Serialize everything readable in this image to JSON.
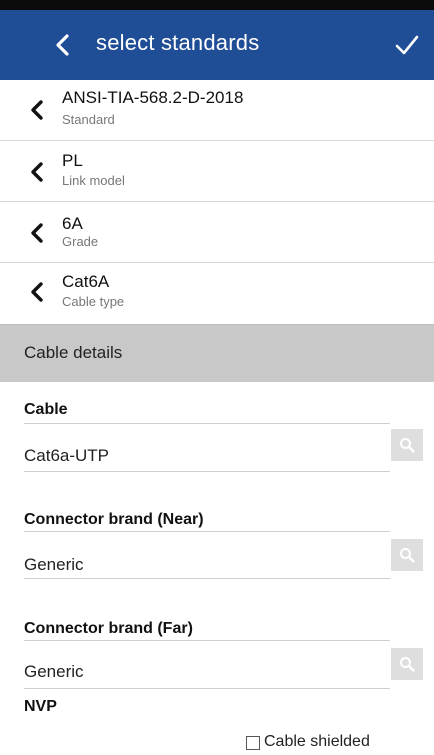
{
  "header": {
    "title": "select standards",
    "back_icon": "chevron-left-icon",
    "confirm_icon": "check-icon",
    "background": "#1f4d96"
  },
  "selections": [
    {
      "value": "ANSI-TIA-568.2-D-2018",
      "label": "Standard"
    },
    {
      "value": "PL",
      "label": "Link model"
    },
    {
      "value": "6A",
      "label": "Grade"
    },
    {
      "value": "Cat6A",
      "label": "Cable type"
    }
  ],
  "section": {
    "title": "Cable details"
  },
  "fields": [
    {
      "label": "Cable",
      "value": "Cat6a-UTP",
      "button_icon": "search-icon"
    },
    {
      "label": "Connector brand (Near)",
      "value": "Generic",
      "button_icon": "search-icon"
    },
    {
      "label": "Connector brand (Far)",
      "value": "Generic",
      "button_icon": "search-icon"
    }
  ],
  "nvp": {
    "label": "NVP"
  },
  "cable_shielded": {
    "label": "Cable shielded",
    "checked": false
  }
}
